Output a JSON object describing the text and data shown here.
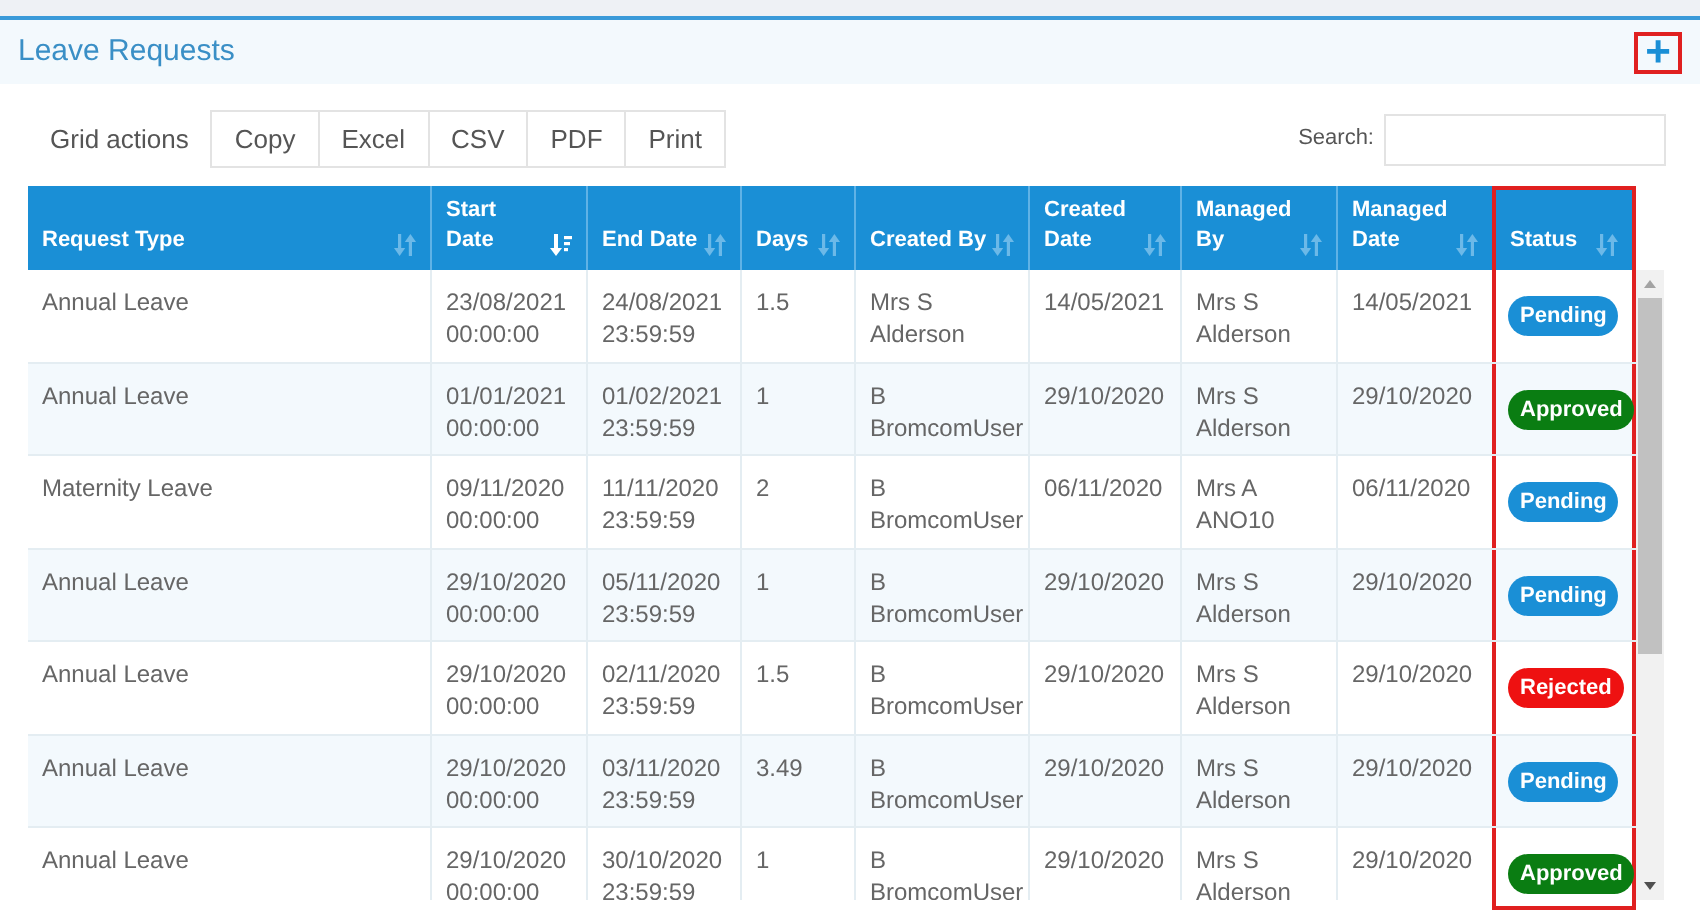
{
  "panel": {
    "title": "Leave Requests",
    "add_button": {
      "label": "+",
      "highlighted": true
    }
  },
  "toolbar": {
    "label": "Grid actions",
    "buttons": [
      "Copy",
      "Excel",
      "CSV",
      "PDF",
      "Print"
    ]
  },
  "search": {
    "label": "Search:"
  },
  "table": {
    "columns": [
      {
        "label": "Request Type",
        "sorted": false,
        "highlighted": false
      },
      {
        "label": "Start Date",
        "sorted": true,
        "highlighted": false
      },
      {
        "label": "End Date",
        "sorted": false,
        "highlighted": false
      },
      {
        "label": "Days",
        "sorted": false,
        "highlighted": false
      },
      {
        "label": "Created By",
        "sorted": false,
        "highlighted": false
      },
      {
        "label": "Created Date",
        "sorted": false,
        "highlighted": false
      },
      {
        "label": "Managed By",
        "sorted": false,
        "highlighted": false
      },
      {
        "label": "Managed Date",
        "sorted": false,
        "highlighted": false
      },
      {
        "label": "Status",
        "sorted": false,
        "highlighted": true
      }
    ],
    "rows": [
      {
        "cells": [
          "Annual Leave",
          "23/08/2021 00:00:00",
          "24/08/2021 23:59:59",
          "1.5",
          "Mrs S Alderson",
          "14/05/2021",
          "Mrs S Alderson",
          "14/05/2021"
        ],
        "status": {
          "label": "Pending",
          "color": "#1a8fd6"
        }
      },
      {
        "cells": [
          "Annual Leave",
          "01/01/2021 00:00:00",
          "01/02/2021 23:59:59",
          "1",
          "B BromcomUser",
          "29/10/2020",
          "Mrs S Alderson",
          "29/10/2020"
        ],
        "status": {
          "label": "Approved",
          "color": "#0a7d12"
        }
      },
      {
        "cells": [
          "Maternity Leave",
          "09/11/2020 00:00:00",
          "11/11/2020 23:59:59",
          "2",
          "B BromcomUser",
          "06/11/2020",
          "Mrs A ANO10",
          "06/11/2020"
        ],
        "status": {
          "label": "Pending",
          "color": "#1a8fd6"
        }
      },
      {
        "cells": [
          "Annual Leave",
          "29/10/2020 00:00:00",
          "05/11/2020 23:59:59",
          "1",
          "B BromcomUser",
          "29/10/2020",
          "Mrs S Alderson",
          "29/10/2020"
        ],
        "status": {
          "label": "Pending",
          "color": "#1a8fd6"
        }
      },
      {
        "cells": [
          "Annual Leave",
          "29/10/2020 00:00:00",
          "02/11/2020 23:59:59",
          "1.5",
          "B BromcomUser",
          "29/10/2020",
          "Mrs S Alderson",
          "29/10/2020"
        ],
        "status": {
          "label": "Rejected",
          "color": "#ee1111"
        }
      },
      {
        "cells": [
          "Annual Leave",
          "29/10/2020 00:00:00",
          "03/11/2020 23:59:59",
          "3.49",
          "B BromcomUser",
          "29/10/2020",
          "Mrs S Alderson",
          "29/10/2020"
        ],
        "status": {
          "label": "Pending",
          "color": "#1a8fd6"
        }
      },
      {
        "cells": [
          "Annual Leave",
          "29/10/2020 00:00:00",
          "30/10/2020 23:59:59",
          "1",
          "B BromcomUser",
          "29/10/2020",
          "Mrs S Alderson",
          "29/10/2020"
        ],
        "status": {
          "label": "Approved",
          "color": "#0a7d12"
        }
      }
    ]
  }
}
